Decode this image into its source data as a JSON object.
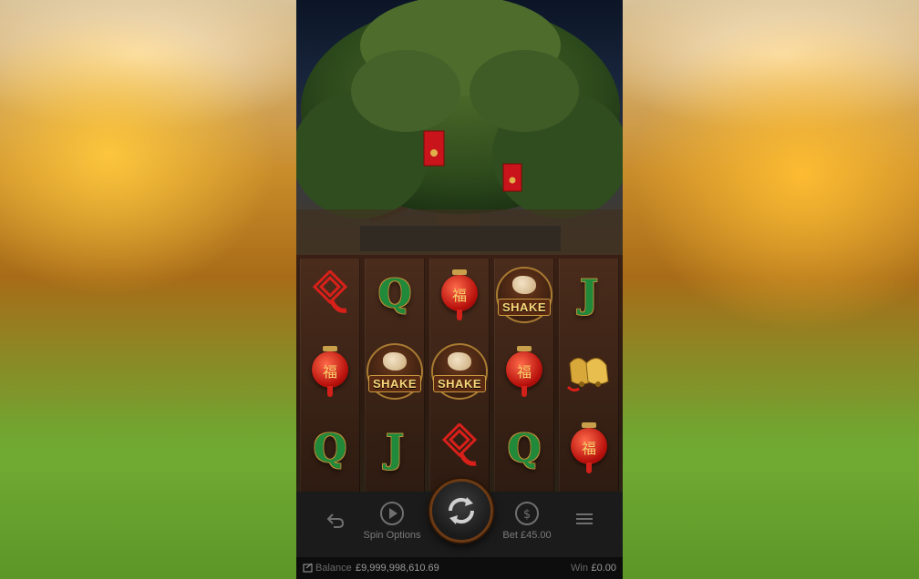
{
  "reels": [
    [
      "knot",
      "lantern",
      "q"
    ],
    [
      "q",
      "shake",
      "j"
    ],
    [
      "lantern",
      "shake",
      "knot"
    ],
    [
      "shake",
      "lantern",
      "q"
    ],
    [
      "j",
      "bells",
      "lantern"
    ]
  ],
  "symbols": {
    "q_letter": "Q",
    "j_letter": "J",
    "shake_word": "SHAKE",
    "lantern_char": "福"
  },
  "controls": {
    "spin_options_label": "Spin Options",
    "bet_label": "Bet",
    "bet_value": "£45.00"
  },
  "status": {
    "balance_label": "Balance",
    "balance_value": "£9,999,998,610.69",
    "win_label": "Win",
    "win_value": "£0.00"
  },
  "colors": {
    "spin_ring": "#6b3a14",
    "symbol_green": "#21893a",
    "lantern_red": "#b8110c"
  }
}
